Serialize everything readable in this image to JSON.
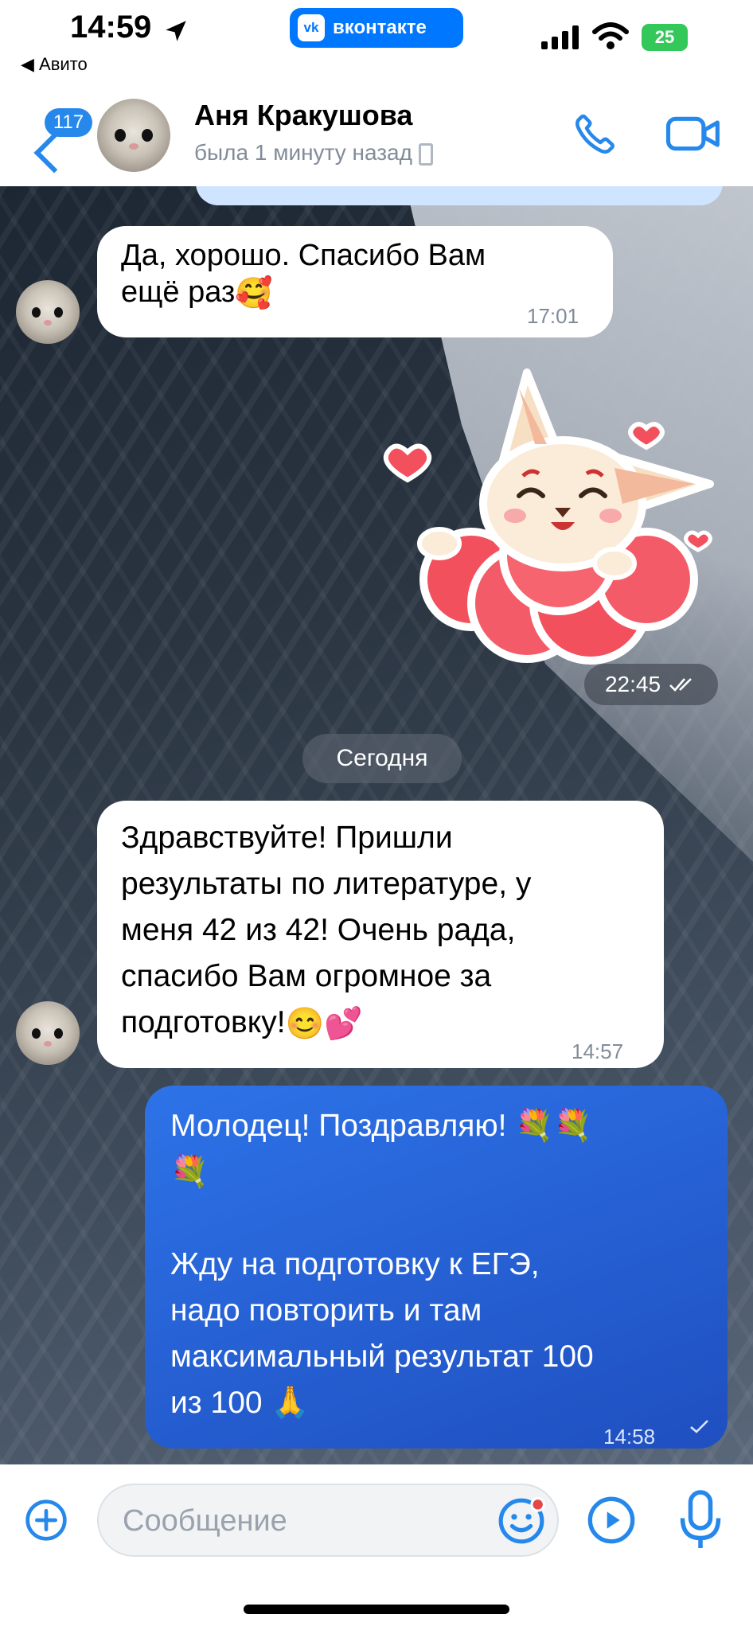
{
  "status_bar": {
    "time": "14:59",
    "back_app": "◀ Авито",
    "center_app": "вконтакте",
    "vk_logo": "vk",
    "battery": "25"
  },
  "header": {
    "unread_badge": "117",
    "name": "Аня Кракушова",
    "status": "была 1 минуту назад",
    "icons": [
      "back-chevron-icon",
      "phone-icon",
      "video-camera-icon"
    ]
  },
  "messages": [
    {
      "direction": "in",
      "text_lines": [
        "Да, хорошо. Спасибо Вам",
        "ещё раз"
      ],
      "emoji": "🥰",
      "time": "17:01"
    },
    {
      "direction": "out",
      "type": "sticker",
      "sticker": "bunny-with-hearts-sticker",
      "time": "22:45"
    },
    {
      "direction": "separator",
      "text": "Сегодня"
    },
    {
      "direction": "in",
      "text_lines": [
        "Здравствуйте! Пришли",
        "результаты по литературе, у",
        "меня 42 из 42! Очень рада,",
        "спасибо Вам огромное за",
        "подготовку!"
      ],
      "emoji": "😊💕",
      "time": "14:57"
    },
    {
      "direction": "out",
      "text_lines": [
        "Молодец! Поздравляю! 💐💐",
        "💐",
        "",
        "Жду на подготовку к ЕГЭ,",
        "надо повторить и там",
        "максимальный результат 100",
        "из 100 🙏"
      ],
      "time": "14:58"
    }
  ],
  "composer": {
    "placeholder": "Сообщение",
    "icons": [
      "add-attachment-icon",
      "emoji-icon",
      "play-icon",
      "microphone-icon"
    ]
  },
  "colors": {
    "accent": "#2688eb",
    "outgoing_bubble": "#2d73e8",
    "vk_brand": "#0077ff"
  }
}
